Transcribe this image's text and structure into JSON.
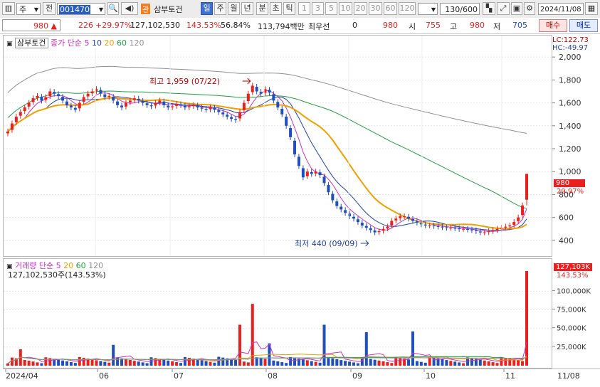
{
  "toolbar": {
    "market_select": "주",
    "prefix_button": "전",
    "stock_code": "001470",
    "badge": "관",
    "stock_name": "삼부토건",
    "periods": [
      "일",
      "주",
      "월",
      "년",
      "분",
      "초",
      "틱"
    ],
    "active_period": "일",
    "intervals": [
      "1",
      "3",
      "5",
      "10",
      "20",
      "30",
      "60",
      "120"
    ],
    "count": "130",
    "count_total": "/600",
    "date": "2024/11/08",
    "icons": [
      "chart-type-icon",
      "tools-icon",
      "save-icon",
      "settings-icon"
    ]
  },
  "quote": {
    "price": "980",
    "change": "226",
    "change_rate": "+29.97%",
    "volume": "127,102,530",
    "volume_rate": "143.53%",
    "turnover": "56.84%",
    "amount": "113,794백만",
    "preferred_label": "최우선",
    "preferred_value": "0",
    "preferred_price": "980",
    "open_label": "시",
    "open": "755",
    "high_label": "고",
    "high": "980",
    "low_label": "저",
    "low": "705",
    "buy_button": "매수",
    "sell_button": "매도",
    "colors": {
      "up": "#e8211e",
      "down": "#1f4fbf"
    }
  },
  "price_pane": {
    "title": "삼부토건",
    "legend_label": "종가 단순",
    "ma": [
      {
        "label": "5",
        "color": "#d030c0"
      },
      {
        "label": "10",
        "color": "#2040b0"
      },
      {
        "label": "20",
        "color": "#f0a000"
      },
      {
        "label": "60",
        "color": "#20a040"
      },
      {
        "label": "120",
        "color": "#909090"
      }
    ],
    "lc": "LC:122.73",
    "hc": "HC:-49.97",
    "high_note": "최고 1,959 (07/22)",
    "low_note": "최저 440 (09/09)",
    "last_price": "980",
    "last_rate": "29.97%"
  },
  "volume_pane": {
    "title": "거래량",
    "legend_label": "단순",
    "ma": [
      {
        "label": "5",
        "color": "#d030c0"
      },
      {
        "label": "20",
        "color": "#f0a000"
      },
      {
        "label": "60",
        "color": "#20a040"
      },
      {
        "label": "120",
        "color": "#909090"
      }
    ],
    "current": "127,102,530주(143.53%)",
    "last_volume": "127,103K",
    "last_rate": "143.53%"
  },
  "chart_data": [
    {
      "type": "candlestick",
      "title": "삼부토건",
      "x_axis_labels": [
        "2024/04",
        "06",
        "07",
        "08",
        "09",
        "10",
        "11"
      ],
      "x_axis_end_label": "11/08",
      "y_ticks": [
        400,
        600,
        800,
        1000,
        1200,
        1400,
        1600,
        1800,
        2000
      ],
      "ylim": [
        300,
        2150
      ],
      "annotations": [
        {
          "label": "최고 1,959 (07/22)",
          "value": 1959
        },
        {
          "label": "최저 440 (09/09)",
          "value": 440
        }
      ],
      "closes": [
        1350,
        1420,
        1480,
        1520,
        1560,
        1600,
        1640,
        1660,
        1620,
        1650,
        1700,
        1680,
        1660,
        1620,
        1580,
        1560,
        1540,
        1600,
        1650,
        1680,
        1700,
        1720,
        1680,
        1650,
        1660,
        1620,
        1580,
        1560,
        1600,
        1620,
        1640,
        1620,
        1600,
        1580,
        1570,
        1600,
        1620,
        1580,
        1560,
        1570,
        1590,
        1580,
        1560,
        1570,
        1580,
        1560,
        1550,
        1540,
        1560,
        1540,
        1520,
        1500,
        1480,
        1460,
        1450,
        1520,
        1600,
        1680,
        1750,
        1700,
        1680,
        1720,
        1690,
        1620,
        1560,
        1500,
        1400,
        1300,
        1150,
        1050,
        950,
        1000,
        980,
        1000,
        970,
        900,
        820,
        750,
        700,
        670,
        640,
        610,
        590,
        560,
        530,
        510,
        490,
        470,
        480,
        500,
        520,
        570,
        590,
        610,
        610,
        590,
        570,
        555,
        540,
        530,
        530,
        525,
        520,
        515,
        510,
        510,
        505,
        500,
        500,
        495,
        490,
        480,
        470,
        470,
        480,
        490,
        500,
        510,
        520,
        530,
        560,
        600,
        705,
        980
      ],
      "last_close": 980,
      "ma_periods": [
        5,
        10,
        20,
        60,
        120
      ]
    },
    {
      "type": "bar",
      "title": "거래량",
      "y_ticks": [
        "25,000K",
        "50,000K",
        "75,000K",
        "100,000K"
      ],
      "ylim": [
        0,
        130000
      ],
      "unit": "K",
      "last_value": 127103,
      "ma_periods": [
        5,
        20,
        60,
        120
      ]
    }
  ]
}
